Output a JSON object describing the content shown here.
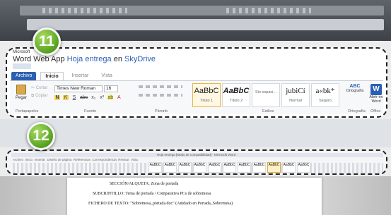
{
  "step_markers": {
    "first": "11",
    "second": "12"
  },
  "webapp": {
    "ms_brand": "Microsoft",
    "app_name": "Word Web App",
    "doc_name": "Hoja entrega",
    "doc_connector": "en",
    "doc_location": "SkyDrive",
    "tabs": [
      {
        "label": "Archivo",
        "state": "file"
      },
      {
        "label": "Inicio",
        "state": "active"
      },
      {
        "label": "Insertar",
        "state": "inactive"
      },
      {
        "label": "Vista",
        "state": "inactive"
      }
    ],
    "clipboard": {
      "paste": "Pegar",
      "cut": "Cortar",
      "copy": "Copiar",
      "group": "Portapapeles"
    },
    "font": {
      "family": "Times New Roman",
      "size": "16",
      "buttons": [
        "N",
        "K",
        "S",
        "abc",
        "x₂",
        "x²",
        "ab",
        "A"
      ],
      "group": "Fuente"
    },
    "paragraph": {
      "group": "Párrafo"
    },
    "styles": {
      "items": [
        {
          "sample": "AaBbC",
          "name": "Título 1",
          "selected": true,
          "weight": "normal",
          "italic": false
        },
        {
          "sample": "AaBbC",
          "name": "Título 2",
          "selected": false,
          "weight": "bold",
          "italic": true
        },
        {
          "sample": "",
          "name": "Sin espaci...",
          "selected": false,
          "weight": "normal",
          "italic": false
        },
        {
          "sample": "jubiCí",
          "name": "Normal",
          "selected": false,
          "weight": "normal",
          "italic": false
        },
        {
          "sample": "a«bk*",
          "name": "Seguro",
          "selected": false,
          "weight": "normal",
          "italic": false
        }
      ],
      "group": "Estilos"
    },
    "spelling": {
      "icon": "ABC",
      "label": "Ortografía",
      "group": "Ortografía"
    },
    "office": {
      "icon": "W",
      "label": "Abrir en Word",
      "group": "Office"
    }
  },
  "desktop_word": {
    "title": "Hoja entrega [Modo de compatibilidad] - Microsoft Word",
    "tabs": [
      "Archivo",
      "Inicio",
      "Insertar",
      "Diseño de página",
      "Referencias",
      "Correspondencia",
      "Revisar",
      "Vista"
    ],
    "style_samples": [
      "AaBbC",
      "AaBbC",
      "AaBbC",
      "AaBbC",
      "AaBbC",
      "AaBbC",
      "AaBbC",
      "AaBbC",
      "AaBbC",
      "AaBbC",
      "AaBbC"
    ],
    "selected_index": 9
  },
  "document": {
    "lines": [
      "SECCIÓN/ALQUETA: Zona de portada",
      "SUBCRINTILLO: Tema de portada / Comparativa PCs de sobremesa",
      "FICHERO DE TEXTO: \"Sobremesa_portada.doc\" (Anidado en Portada_Sobremesa)"
    ]
  },
  "colors": {
    "accent": "#2b5fb3",
    "badge": "#56a21f",
    "selected_style": "#e8b54a"
  }
}
